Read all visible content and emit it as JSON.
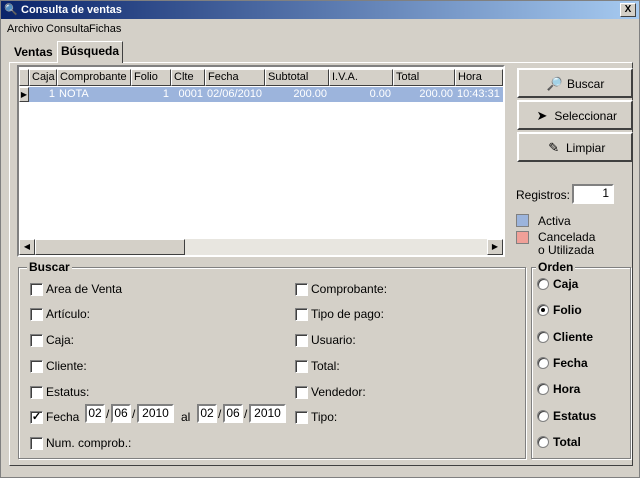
{
  "window": {
    "title": "Consulta de ventas",
    "close_glyph": "X"
  },
  "menu": [
    "Archivo",
    "Consulta",
    "Fichas"
  ],
  "tabs": [
    "Ventas",
    "Búsqueda"
  ],
  "grid": {
    "columns": [
      "Caja",
      "Comprobante",
      "Folio",
      "Clte",
      "Fecha",
      "Subtotal",
      "I.V.A.",
      "Total",
      "Hora"
    ],
    "rows": [
      [
        "1",
        "NOTA",
        "1",
        "0001",
        "02/06/2010",
        "200.00",
        "0.00",
        "200.00",
        "10:43:31"
      ]
    ]
  },
  "buttons": {
    "buscar": "Buscar",
    "seleccionar": "Seleccionar",
    "limpiar": "Limpiar"
  },
  "registros": {
    "label": "Registros:",
    "value": "1"
  },
  "legend": [
    {
      "label": "Activa",
      "color": "#9cb4dc"
    },
    {
      "label": "Cancelada",
      "label2": "o Utilizada",
      "color": "#f0a098"
    }
  ],
  "buscar": {
    "title": "Buscar",
    "left": [
      {
        "label": "Area de Venta",
        "checked": false
      },
      {
        "label": "Artículo:",
        "checked": false
      },
      {
        "label": "Caja:",
        "checked": false
      },
      {
        "label": "Cliente:",
        "checked": false
      },
      {
        "label": "Estatus:",
        "checked": false
      },
      {
        "label": "Fecha",
        "checked": true
      },
      {
        "label": "Num. comprob.:",
        "checked": false
      }
    ],
    "right": [
      {
        "label": "Comprobante:",
        "checked": false
      },
      {
        "label": "Tipo de pago:",
        "checked": false
      },
      {
        "label": "Usuario:",
        "checked": false
      },
      {
        "label": "Total:",
        "checked": false
      },
      {
        "label": "Vendedor:",
        "checked": false
      },
      {
        "label": "Tipo:",
        "checked": false
      }
    ],
    "date_from": {
      "day": "02",
      "month": "06",
      "year": "2010"
    },
    "date_to": {
      "day": "02",
      "month": "06",
      "year": "2010"
    },
    "date_sep": "/",
    "al_label": "al"
  },
  "orden": {
    "title": "Orden",
    "options": [
      "Caja",
      "Folio",
      "Cliente",
      "Fecha",
      "Hora",
      "Estatus",
      "Total"
    ],
    "selected": "Folio"
  }
}
